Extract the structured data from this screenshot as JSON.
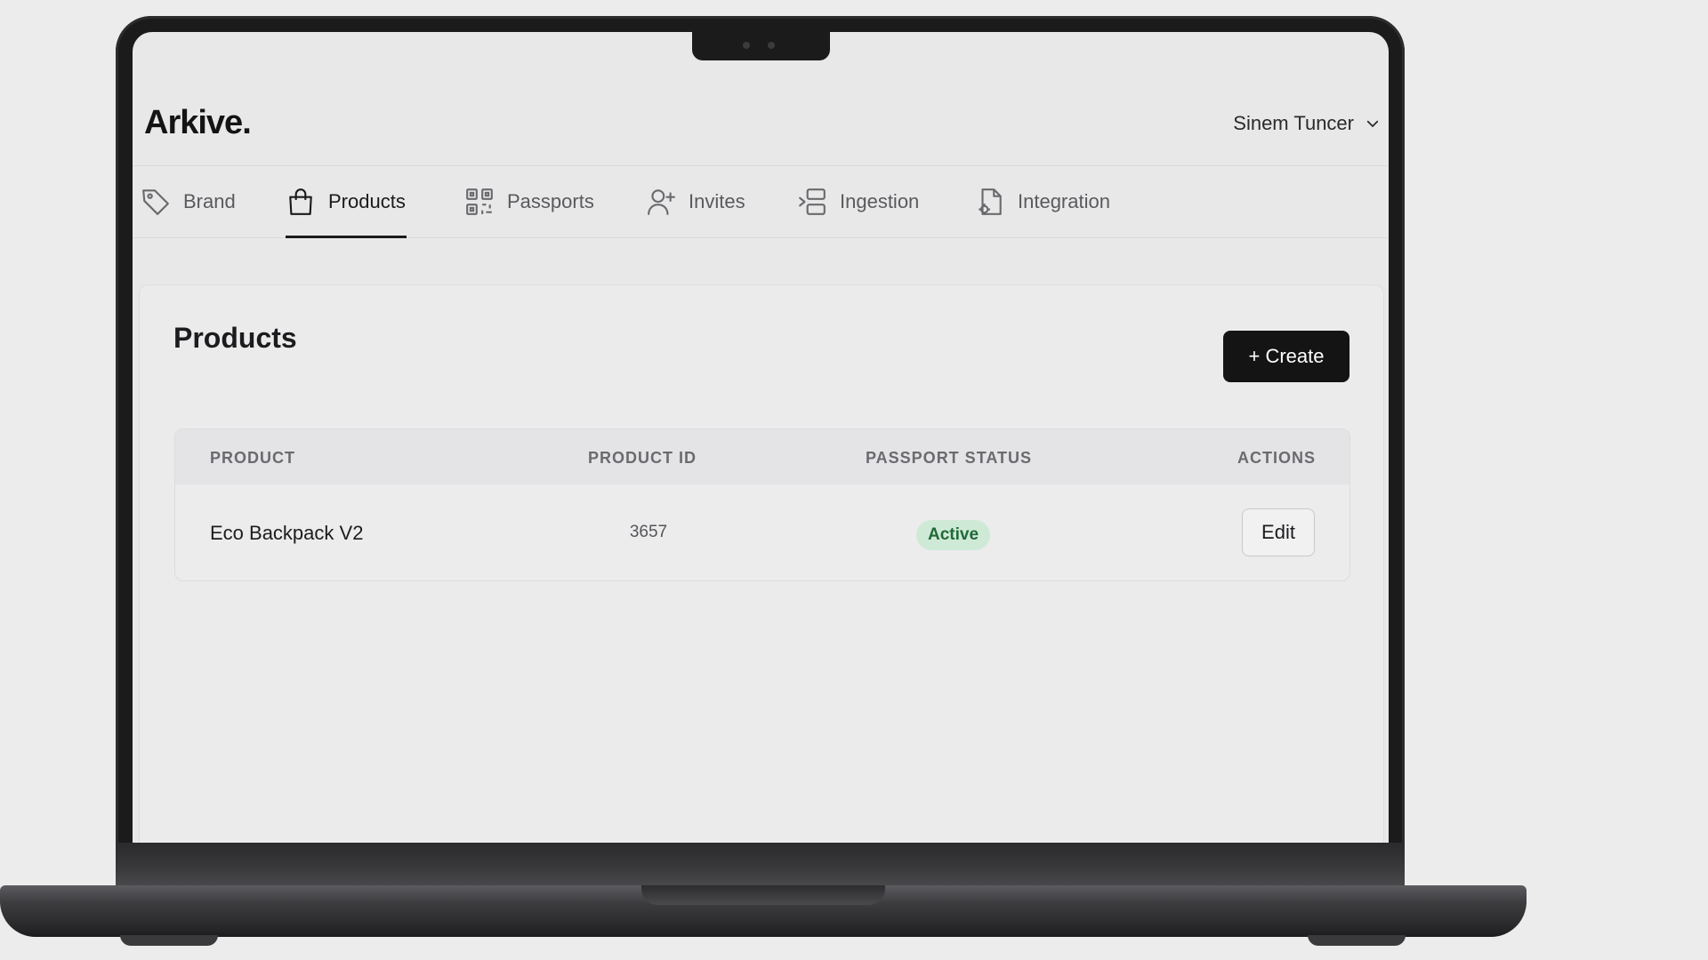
{
  "app": {
    "logo": "Arkive.",
    "user_name": "Sinem Tuncer"
  },
  "tabs": [
    {
      "label": "Brand",
      "icon": "tag-icon",
      "active": false
    },
    {
      "label": "Products",
      "icon": "shopping-bag-icon",
      "active": true
    },
    {
      "label": "Passports",
      "icon": "qr-code-icon",
      "active": false
    },
    {
      "label": "Invites",
      "icon": "user-plus-icon",
      "active": false
    },
    {
      "label": "Ingestion",
      "icon": "import-icon",
      "active": false
    },
    {
      "label": "Integration",
      "icon": "file-settings-icon",
      "active": false
    }
  ],
  "page": {
    "title": "Products",
    "create_label": "+ Create"
  },
  "table": {
    "columns": [
      "PRODUCT",
      "PRODUCT ID",
      "PASSPORT STATUS",
      "ACTIONS"
    ],
    "rows": [
      {
        "product": "Eco Backpack V2",
        "product_id": "3657",
        "status": "Active",
        "action": "Edit"
      }
    ]
  },
  "colors": {
    "accent": "#141414",
    "status_active_bg": "#cfe9d7",
    "status_active_text": "#1f6a37"
  }
}
